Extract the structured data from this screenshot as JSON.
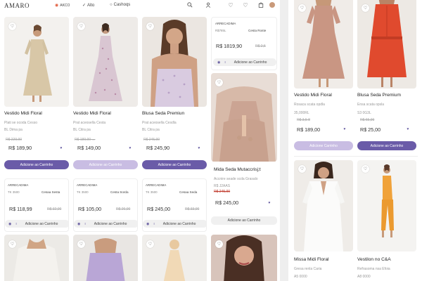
{
  "header": {
    "logo": "AMARO",
    "nav": [
      {
        "label": "AKCO",
        "icon": "dot-icon"
      },
      {
        "label": "Alto",
        "icon": "check-icon"
      },
      {
        "label": "Cashoqs",
        "icon": "circle-icon"
      }
    ]
  },
  "grid": {
    "row1": [
      {
        "name": "Vestido Midi Floral",
        "sub": "Plati se ocoda Cesso",
        "sub2": "BL Dima pa",
        "old": "R$ 229,90",
        "price": "R$ 189,90",
        "button": "Adicione ao Carrinho"
      },
      {
        "name": "Vestido Midi Floral",
        "sub": "Prat aceosella Cesta",
        "sub2": "BL Citra pa",
        "old": "R$ 189,90 ↔",
        "price": "R$ 149,00",
        "button": "Adicione ao Carrinho"
      },
      {
        "name": "Blusa Seda Premiun",
        "sub": "Prat aceosella Cesdla",
        "sub2": "BL Citra pa",
        "old": "R$ 245,90",
        "price": "R$ 245,90",
        "button": "Adicione ao Carrinho"
      }
    ],
    "col4_top": {
      "tag": "ARRECADIMA",
      "tag2": "R$785L",
      "store": "Cesta Roste",
      "price": "R$ 1819,90",
      "old": "R$ 2,5",
      "bar": "Adicione ao Carrinho"
    },
    "col4_card": {
      "name": "Mida Seda Mutaccrisj;t",
      "sub": "Accnire seade scda Grasalo",
      "sub2": "R$ J2AAS",
      "old": "R$ 245,00",
      "price": "R$ 245,00",
      "button": "Adicione ao Carrinho"
    },
    "row2": [
      {
        "tag": "ARRECADIMA",
        "tag2": "TK 3500",
        "store": "Cesaa Sesta",
        "price": "R$ 118,99",
        "old": "R$ 32,00",
        "bar": "Adicione ao Carrinho"
      },
      {
        "tag": "ARRECADIMA",
        "tag2": "TK 3500",
        "store": "Cesta Sorda",
        "price": "R$ 105,00",
        "old": "R$ 26,00",
        "bar": "Adicione ao Carrinho"
      },
      {
        "tag": "ARRECADIMA",
        "tag2": "TK 3500",
        "store": "Cesaa Seda",
        "price": "R$ 245,00",
        "old": "R$ 33,00",
        "bar": "Adicione ao Carrinho"
      }
    ]
  },
  "right": {
    "products": [
      {
        "name": "Vestido Midi Floral",
        "sub": "Rosaca scata opdla",
        "sub2": "35,000RL",
        "old": "R$ 3,5 8",
        "price": "R$ 189,00",
        "button": "Adicione Carrinho",
        "button_style": "light"
      },
      {
        "name": "Blusa Seda Premium",
        "sub": "Ensa scata opsla",
        "sub2": "S3 0G3L",
        "old": "R$ 65,99",
        "price": "R$ 25,00",
        "button": "Adicione ao Carrinho",
        "button_style": "dark"
      },
      {
        "name": "Missa Midi Floral",
        "sub": "Gresa renla Caria",
        "sub2": "A5 0000",
        "old": "",
        "price": "",
        "button": "",
        "button_style": ""
      },
      {
        "name": "Vestilon no C&A",
        "sub": "Refrasoma nsa Efoia",
        "sub2": "A8 0000",
        "old": "",
        "price": "",
        "button": "",
        "button_style": ""
      }
    ]
  },
  "colors": {
    "accent": "#6a5ba8",
    "accent_light": "#c9bde3",
    "price_heart": "#5a4f9a"
  }
}
